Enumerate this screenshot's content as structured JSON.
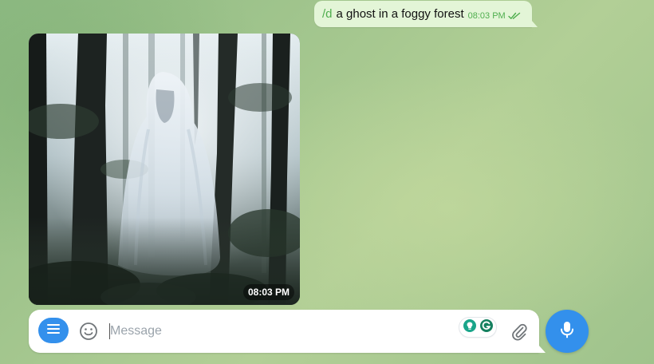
{
  "outgoing_message": {
    "command": "/d",
    "text": "a ghost in a foggy forest",
    "time": "08:03 PM",
    "status_icon": "double-check-icon"
  },
  "photo_message": {
    "time": "08:03 PM"
  },
  "composer": {
    "placeholder": "Message",
    "menu_icon": "hamburger-menu-icon",
    "emoji_icon": "smiley-icon",
    "attach_icon": "paperclip-icon",
    "mic_icon": "microphone-icon"
  },
  "colors": {
    "accent": "#3390ec",
    "outgoing_bubble": "#e3f5d7",
    "outgoing_meta": "#4fae4e"
  }
}
